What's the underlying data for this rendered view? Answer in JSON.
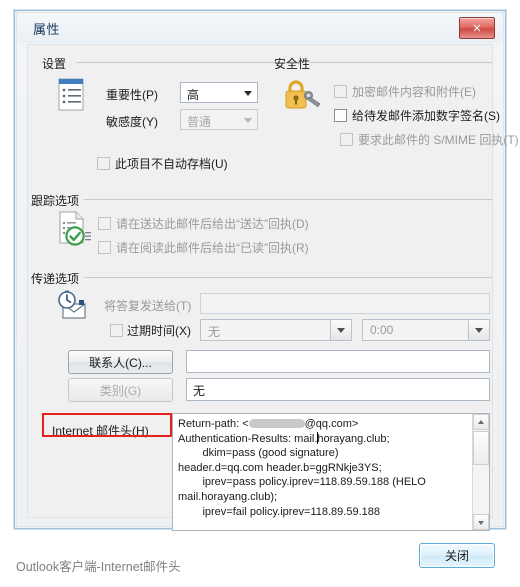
{
  "window": {
    "title": "属性",
    "close_button_glyph": "✕"
  },
  "groups": {
    "settings": {
      "title": "设置"
    },
    "security": {
      "title": "安全性"
    },
    "tracking": {
      "title": "跟踪选项"
    },
    "delivery": {
      "title": "传递选项"
    }
  },
  "settings": {
    "importance_label": "重要性(P)",
    "importance_value": "高",
    "sensitivity_label": "敏感度(Y)",
    "sensitivity_value": "普通",
    "no_autoarchive_label": "此项目不自动存档(U)",
    "no_autoarchive_checked": false
  },
  "security": {
    "encrypt_label": "加密邮件内容和附件(E)",
    "encrypt_checked": false,
    "sign_label": "给待发邮件添加数字签名(S)",
    "sign_checked": false,
    "smime_label": "要求此邮件的 S/MIME 回执(T)",
    "smime_checked": false
  },
  "tracking": {
    "delivery_receipt_label": "请在送达此邮件后给出“送达”回执(D)",
    "delivery_receipt_checked": false,
    "read_receipt_label": "请在阅读此邮件后给出“已读”回执(R)",
    "read_receipt_checked": false
  },
  "delivery": {
    "reply_to_label": "将答复发送给(T)",
    "reply_to_value": "",
    "expires_label": "过期时间(X)",
    "expires_checked": false,
    "expires_date_value": "无",
    "expires_time_value": "0:00",
    "contacts_button": "联系人(C)...",
    "contacts_value": "",
    "categories_button": "类别(G)",
    "categories_value": "无"
  },
  "headers": {
    "label": "Internet 邮件头(H)",
    "line1_prefix": "Return-path: <",
    "line1_suffix": "@qq.com>",
    "lines": [
      "Authentication-Results: mail.horayang.club;",
      "        dkim=pass (good signature)",
      "header.d=qq.com header.b=ggRNkje3YS;",
      "        iprev=pass policy.iprev=118.89.59.188 (HELO",
      "mail.horayang.club);",
      "        iprev=fail policy.iprev=118.89.59.188"
    ]
  },
  "footer": {
    "close_label": "关闭"
  },
  "caption": "Outlook客户端-Internet邮件头",
  "colors": {
    "annotation_red": "#e8201e",
    "title_blue": "#16355c",
    "caption_gray": "#7f7f7f",
    "lock_gold": "#e2a72c",
    "check_green": "#3e9e4d",
    "accent_blue": "#5da9d8"
  }
}
